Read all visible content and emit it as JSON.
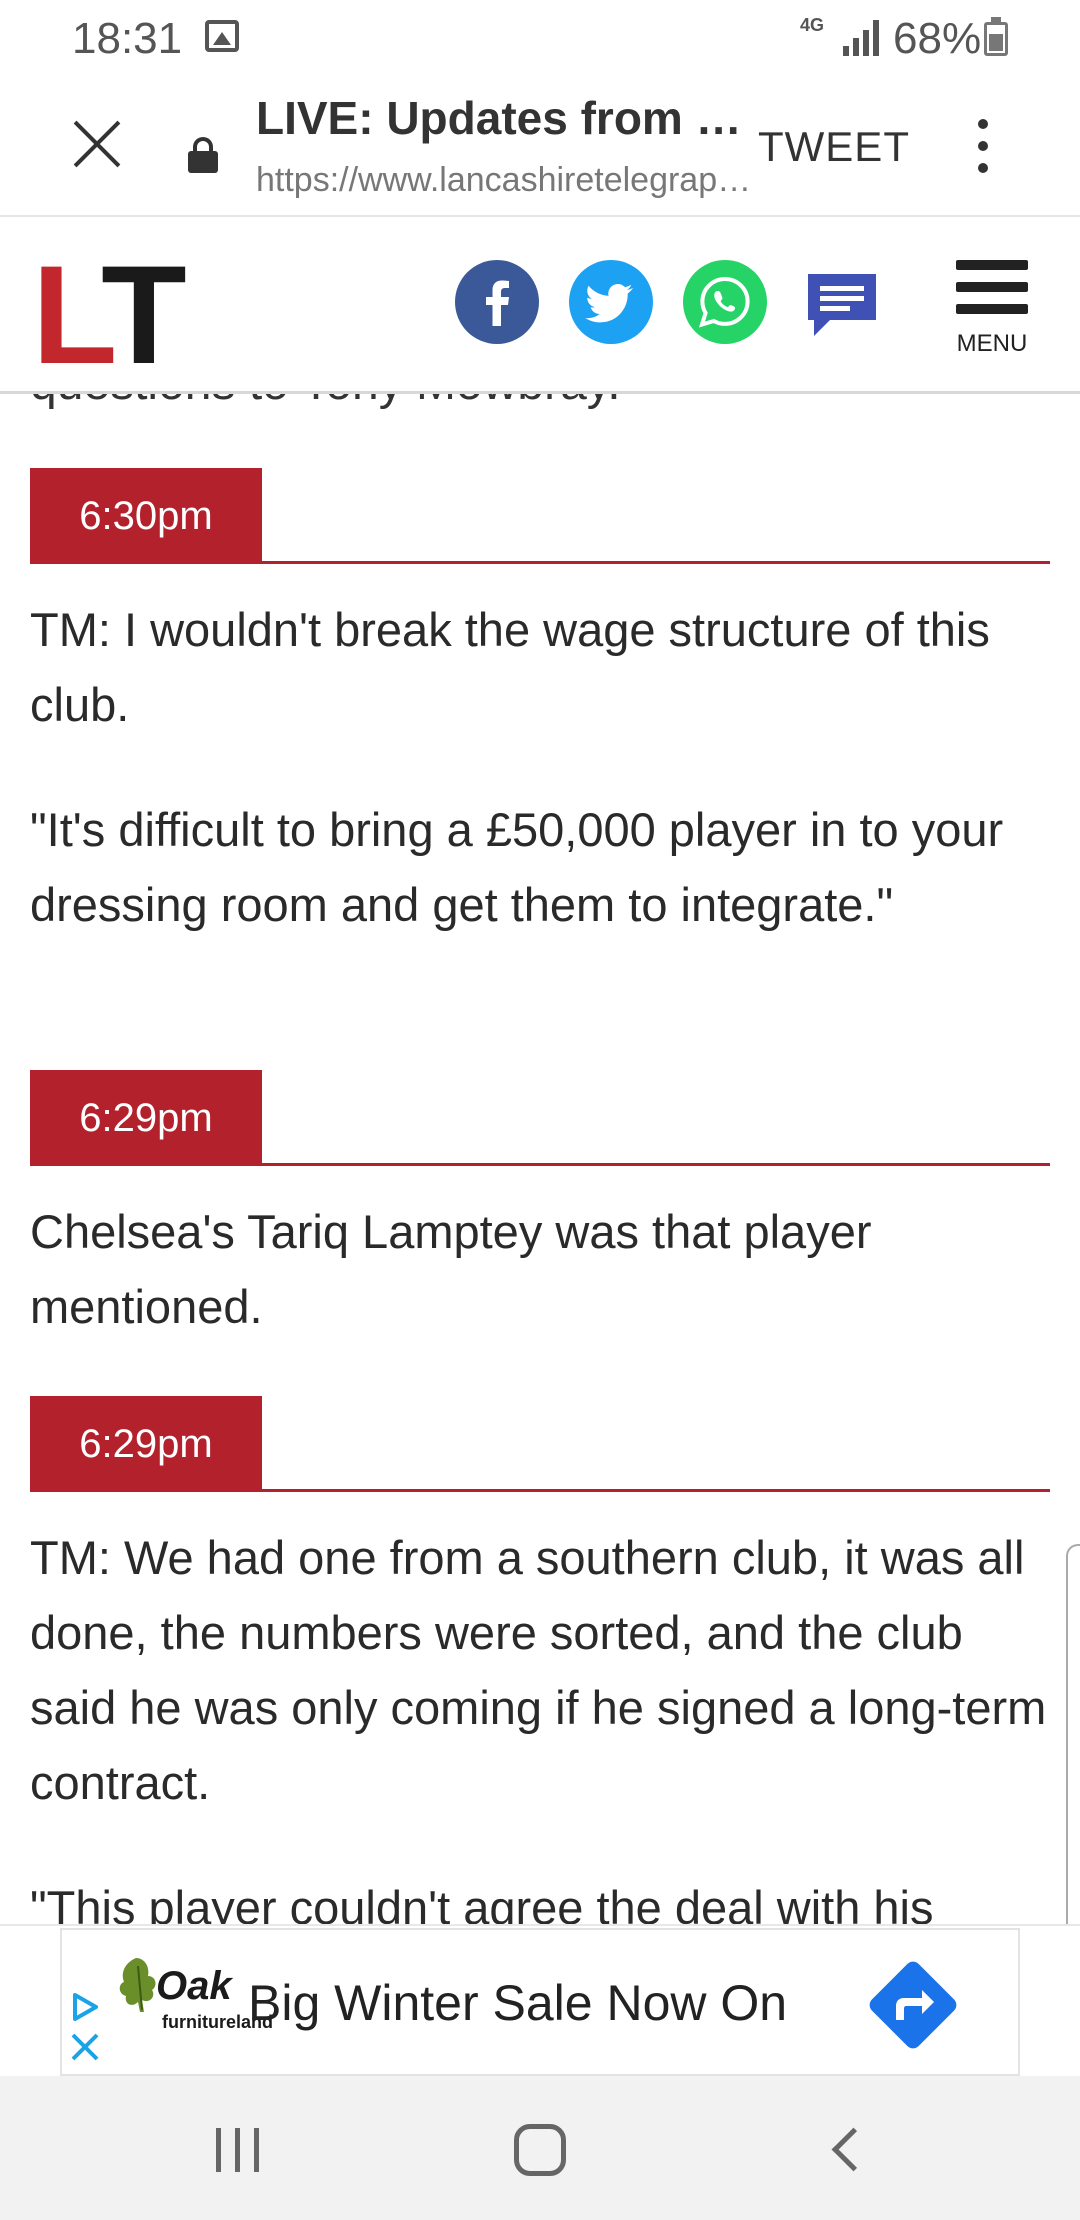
{
  "status_bar": {
    "time": "18:31",
    "network": "4G",
    "battery_pct": "68%"
  },
  "toolbar": {
    "title": "LIVE: Updates from Ro…",
    "url": "https://www.lancashiretelegrap…",
    "tweet_label": "TWEET"
  },
  "header": {
    "logo_l": "L",
    "logo_t": "T",
    "menu_label": "MENU",
    "share_colors": {
      "facebook": "#3b5998",
      "twitter": "#1da1f2",
      "whatsapp": "#25d366",
      "comments": "#3f51b5"
    }
  },
  "article": {
    "cutoff_text": "questions to Tony Mowbray.",
    "entries": [
      {
        "time": "6:30pm",
        "paragraphs": [
          "TM: I wouldn't break the wage structure of this club.",
          "\"It's difficult to bring a £50,000 player in to your dressing room and get them to integrate.\""
        ]
      },
      {
        "time": "6:29pm",
        "paragraphs": [
          "Chelsea's Tariq Lamptey was that player mentioned."
        ]
      },
      {
        "time": "6:29pm",
        "paragraphs": [
          "TM: We had one from a southern club, it was all done, the numbers were sorted, and the club said he was only coming if he signed a long-term contract.",
          "\"This player couldn't agree the deal with his"
        ]
      }
    ],
    "accent_color": "#b3222c"
  },
  "ad": {
    "brand": "Oak",
    "brand_sub": "furnitureland",
    "text": "Big Winter Sale Now On",
    "cta_color": "#1a73e8"
  }
}
